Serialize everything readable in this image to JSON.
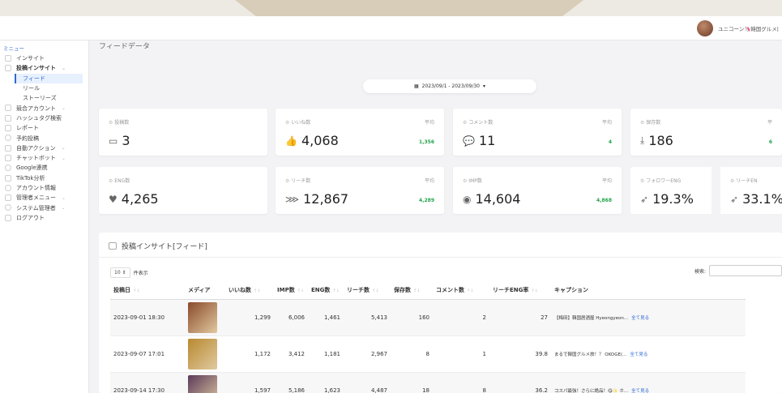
{
  "header": {
    "user_name": "ユニコーン🦄韓国グルメ|"
  },
  "sidebar": {
    "menu_title": "ミニュー",
    "items": [
      {
        "label": "インサイト",
        "arrow": ""
      },
      {
        "label": "投稿インサイト",
        "arrow": "⌄"
      },
      {
        "label": "フィード",
        "arrow": ""
      },
      {
        "label": "リール",
        "arrow": ""
      },
      {
        "label": "ストーリーズ",
        "arrow": ""
      },
      {
        "label": "競合アカウント",
        "arrow": "⌄"
      },
      {
        "label": "ハッシュタグ検索",
        "arrow": ""
      },
      {
        "label": "レポート",
        "arrow": ""
      },
      {
        "label": "予約投稿",
        "arrow": ""
      },
      {
        "label": "自動アクション",
        "arrow": "⌄"
      },
      {
        "label": "チャットボット",
        "arrow": "⌄"
      },
      {
        "label": "Google連携",
        "arrow": ""
      },
      {
        "label": "TikTok分析",
        "arrow": ""
      },
      {
        "label": "アカウント情報",
        "arrow": ""
      },
      {
        "label": "管理者メニュー",
        "arrow": "⌄"
      },
      {
        "label": "システム管理者",
        "arrow": "⌄"
      },
      {
        "label": "ログアウト",
        "arrow": ""
      }
    ]
  },
  "main": {
    "page_title": "フィードデータ",
    "date_range": "2023/09/1 - 2023/09/30",
    "date_caret": "▾",
    "calendar_glyph": "▦"
  },
  "cards_row1": [
    {
      "label": "投稿数",
      "value": "3",
      "avg_label": "",
      "avg": "",
      "icon": "monitor-icon",
      "glyph": "▭"
    },
    {
      "label": "いいね数",
      "value": "4,068",
      "avg_label": "平均",
      "avg": "1,356",
      "icon": "thumbs-up-icon",
      "glyph": "👍"
    },
    {
      "label": "コメント数",
      "value": "11",
      "avg_label": "平均",
      "avg": "4",
      "icon": "comment-icon",
      "glyph": "💬"
    },
    {
      "label": "保存数",
      "value": "186",
      "avg_label": "平",
      "avg": "6",
      "icon": "save-icon",
      "glyph": "⤓"
    }
  ],
  "cards_row2": [
    {
      "label": "ENG数",
      "value": "4,265",
      "avg_label": "",
      "avg": "",
      "icon": "heart-icon",
      "glyph": "♥"
    },
    {
      "label": "リーチ数",
      "value": "12,867",
      "avg_label": "平均",
      "avg": "4,289",
      "icon": "rss-icon",
      "glyph": "⋙"
    },
    {
      "label": "IMP数",
      "value": "14,604",
      "avg_label": "平均",
      "avg": "4,868",
      "icon": "eye-icon",
      "glyph": "◉"
    },
    {
      "label": "フォロワーENG",
      "value": "19.3%",
      "avg_label": "",
      "avg": "",
      "icon": "send-icon",
      "glyph": "➶"
    },
    {
      "label": "リーチEN",
      "value": "33.1%",
      "avg_label": "",
      "avg": "",
      "icon": "send-icon",
      "glyph": "➶"
    }
  ],
  "panel": {
    "title": "投稿インサイト[フィード]",
    "length_value": "10 ⇕",
    "length_label": "件表示",
    "search_label": "検索:",
    "search_placeholder": ""
  },
  "table": {
    "columns": [
      "投稿日",
      "メディア",
      "いいね数",
      "IMP数",
      "ENG数",
      "リーチ数",
      "保存数",
      "コメント数",
      "リーチENG率",
      "キャプション"
    ],
    "sort_glyph": "↑↓",
    "rows": [
      {
        "date": "2023-09-01 18:30",
        "likes": "1,299",
        "imp": "6,006",
        "eng": "1,461",
        "reach": "5,413",
        "saves": "160",
        "comments": "2",
        "rate": "27",
        "caption": "【梅田】韓国居酒屋 Hyeongyeon...",
        "link": "全て見る",
        "thumb": "#8a4a2a"
      },
      {
        "date": "2023-09-07 17:01",
        "likes": "1,172",
        "imp": "3,412",
        "eng": "1,181",
        "reach": "2,967",
        "saves": "8",
        "comments": "1",
        "rate": "39.8",
        "caption": "まるで韓国グルメ旅！？ OKOGE(...",
        "link": "全て見る",
        "thumb": "#b8892f"
      },
      {
        "date": "2023-09-14 17:30",
        "likes": "1,597",
        "imp": "5,186",
        "eng": "1,623",
        "reach": "4,487",
        "saves": "18",
        "comments": "8",
        "rate": "36.2",
        "caption": "コスパ最強！さらに絶品！😋✨ ホ...",
        "link": "全て見る",
        "thumb": "#5a3a5a"
      }
    ]
  }
}
